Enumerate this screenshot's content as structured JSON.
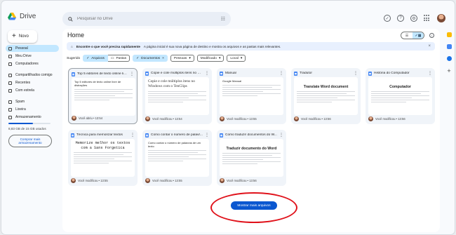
{
  "app": {
    "name": "Drive"
  },
  "search": {
    "placeholder": "Pesquisar no Drive"
  },
  "sidebar": {
    "new_label": "Novo",
    "items": [
      {
        "label": "Pessoal",
        "active": true
      },
      {
        "label": "Meu Drive"
      },
      {
        "label": "Computadores"
      },
      {
        "label": "Compartilhados comigo"
      },
      {
        "label": "Recentes"
      },
      {
        "label": "Com estrela"
      },
      {
        "label": "Spam"
      },
      {
        "label": "Lixeira"
      },
      {
        "label": "Armazenamento"
      }
    ],
    "storage_used_fraction": 0.59,
    "storage_text": "8,83 GB de 15 GB usados",
    "buy_storage_label": "Comprar mais armazenamento"
  },
  "main": {
    "title": "Home",
    "banner": {
      "bold": "Encontre o que você precisa rapidamente",
      "text": "A página inicial é sua nova página de destino e mostra os arquivos e as pastas mais relevantes."
    },
    "filters": {
      "label": "Sugerido",
      "files": "Arquivos",
      "folders": "Pastas",
      "documents": "Documentos",
      "people": "Pessoas",
      "modified": "Modificado",
      "location": "Local"
    },
    "cards": [
      {
        "title": "Top 5 editores de texto online livr...",
        "thumb_kind": "small",
        "thumb_title": "Top 5 editores de texto online livre de distrações",
        "meta": "Você abriu • 13:54"
      },
      {
        "title": "Copie e cole múltiplos itens no Wi...",
        "thumb_kind": "serif",
        "thumb_title": "Copie e cole múltiplos itens no Windows com o TenClips",
        "meta": "Você modificou • 13:54"
      },
      {
        "title": "Manual",
        "thumb_kind": "small",
        "thumb_title": "Google Manual",
        "meta": "Você modificou • 13:55"
      },
      {
        "title": "Tradutor",
        "thumb_kind": "center",
        "thumb_title": "Translate Word document",
        "meta": "Você modificou • 13:56"
      },
      {
        "title": "História do Computador",
        "thumb_kind": "center",
        "thumb_title": "Computador",
        "meta": "Você modificou • 13:56"
      },
      {
        "title": "Técnica para memorizar textos",
        "thumb_kind": "mono",
        "thumb_title": "Memorize melhor os textos com a Sans Forgetica",
        "meta": "Você modificou • 13:55"
      },
      {
        "title": "Como contar o número de palavr...",
        "thumb_kind": "small",
        "thumb_title": "Como contar o número de palavras de um texto",
        "meta": "Você modificou • 13:55"
      },
      {
        "title": "Como traduzir documentos do W...",
        "thumb_kind": "center",
        "thumb_title": "Traduzir documento do Word",
        "meta": "Você modificou • 13:56"
      }
    ],
    "show_more_label": "Mostrar mais arquivos"
  },
  "colors": {
    "accent": "#0b57d0",
    "selected": "#c2e7ff",
    "annotation": "#e0121b"
  }
}
